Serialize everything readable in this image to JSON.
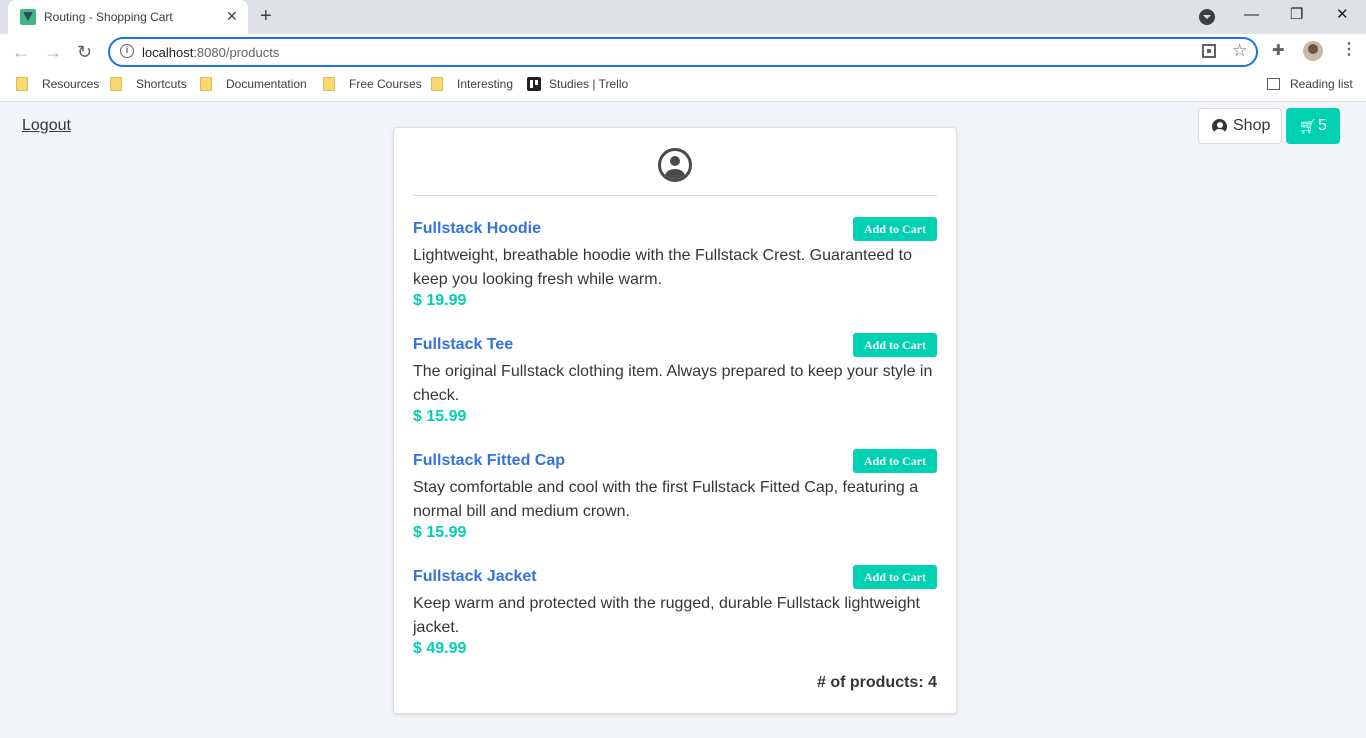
{
  "browser": {
    "tab_title": "Routing - Shopping Cart",
    "url_host": "localhost",
    "url_rest": ":8080/products",
    "bookmarks": [
      "Resources",
      "Shortcuts",
      "Documentation",
      "Free Courses",
      "Interesting",
      "Studies | Trello"
    ],
    "reading_list": "Reading list"
  },
  "header": {
    "logout": "Logout",
    "shop_label": "Shop",
    "cart_count": "5"
  },
  "products": [
    {
      "name": "Fullstack Hoodie",
      "description": "Lightweight, breathable hoodie with the Fullstack Crest. Guaranteed to keep you looking fresh while warm.",
      "price": "$ 19.99",
      "button": "Add to Cart"
    },
    {
      "name": "Fullstack Tee",
      "description": "The original Fullstack clothing item. Always prepared to keep your style in check.",
      "price": "$ 15.99",
      "button": "Add to Cart"
    },
    {
      "name": "Fullstack Fitted Cap",
      "description": "Stay comfortable and cool with the first Fullstack Fitted Cap, featuring a normal bill and medium crown.",
      "price": "$ 15.99",
      "button": "Add to Cart"
    },
    {
      "name": "Fullstack Jacket",
      "description": "Keep warm and protected with the rugged, durable Fullstack lightweight jacket.",
      "price": "$ 49.99",
      "button": "Add to Cart"
    }
  ],
  "footer": {
    "product_count": "# of products: 4"
  },
  "colors": {
    "accent": "#00d1b2",
    "link": "#3273dc"
  }
}
